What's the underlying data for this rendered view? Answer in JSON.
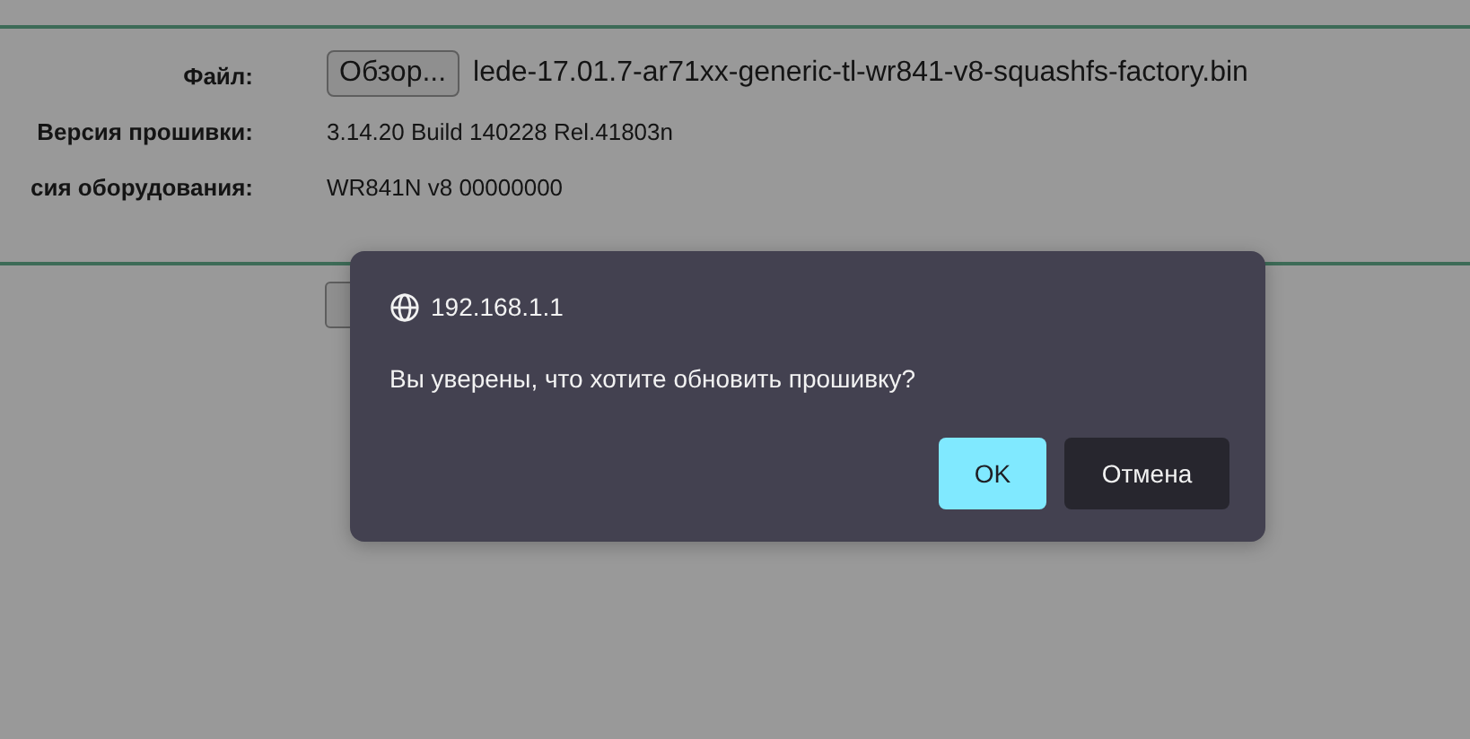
{
  "form": {
    "file": {
      "label": "Файл:",
      "button": "Обзор...",
      "filename": "lede-17.01.7-ar71xx-generic-tl-wr841-v8-squashfs-factory.bin"
    },
    "rows": [
      {
        "label": "Версия прошивки:",
        "value": "3.14.20 Build 140228 Rel.41803n"
      },
      {
        "label": "сия оборудования:",
        "value": "WR841N v8 00000000"
      }
    ]
  },
  "dialog": {
    "origin": "192.168.1.1",
    "message": "Вы уверены, что хотите обновить прошивку?",
    "buttons": [
      {
        "label": "OK",
        "kind": "primary"
      },
      {
        "label": "Отмена",
        "kind": "secondary"
      }
    ]
  }
}
